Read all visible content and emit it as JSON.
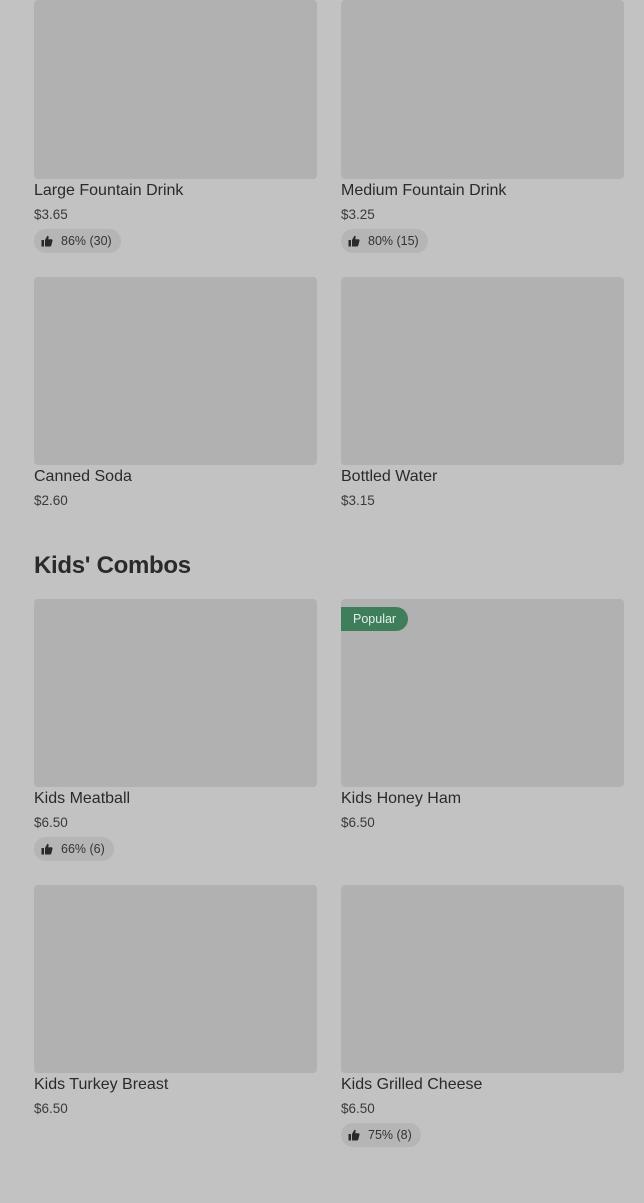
{
  "drinks": [
    {
      "name": "Large Fountain Drink",
      "price": "$3.65",
      "rating": "86% (30)"
    },
    {
      "name": "Medium Fountain Drink",
      "price": "$3.25",
      "rating": "80% (15)"
    },
    {
      "name": "Canned Soda",
      "price": "$2.60"
    },
    {
      "name": "Bottled Water",
      "price": "$3.15"
    }
  ],
  "kids_combos": {
    "title": "Kids' Combos",
    "items": [
      {
        "name": "Kids Meatball",
        "price": "$6.50",
        "rating": "66% (6)"
      },
      {
        "name": "Kids Honey Ham",
        "price": "$6.50",
        "badge": "Popular"
      },
      {
        "name": "Kids Turkey Breast",
        "price": "$6.50"
      },
      {
        "name": "Kids Grilled Cheese",
        "price": "$6.50",
        "rating": "75% (8)"
      }
    ]
  },
  "icons": {
    "rating": "thumbs-up-icon"
  },
  "colors": {
    "background": "#c2c2c2",
    "image_placeholder": "#b1b1b1",
    "popular_badge": "#3f7e5b"
  }
}
